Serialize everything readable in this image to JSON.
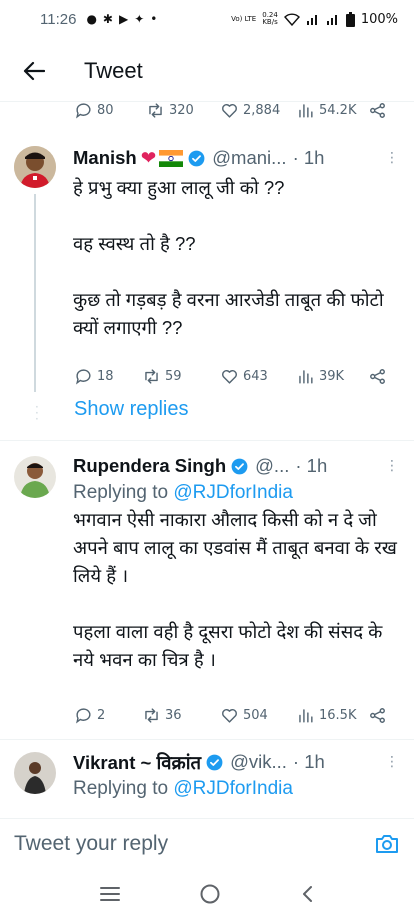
{
  "status_bar": {
    "time": "11:26",
    "network_top": "Vo) LTE",
    "speed_value": "0.24",
    "speed_unit": "KB/s",
    "battery": "100%"
  },
  "header": {
    "title": "Tweet"
  },
  "top_actions": {
    "replies": "80",
    "retweets": "320",
    "likes": "2,884",
    "views": "54.2K"
  },
  "tweets": [
    {
      "name": "Manish",
      "handle": "@mani...",
      "time": "· 1h",
      "text": "हे प्रभु क्या हुआ लालू जी को ??\n\nवह स्वस्थ तो है ??\n\nकुछ तो गड़बड़ है वरना आरजेडी ताबूत की फोटो क्यों लगाएगी  ??",
      "replies": "18",
      "retweets": "59",
      "likes": "643",
      "views": "39K"
    },
    {
      "name": "Rupendera Singh",
      "handle": "@...",
      "time": "· 1h",
      "replying_prefix": "Replying to",
      "replying_to": "@RJDforIndia",
      "text": "भगवान ऐसी नाकारा औलाद किसी को न दे जो अपने बाप लालू का एडवांस मैं ताबूत बनवा के रख लिये हैं ।\n\nपहला वाला वही है दूसरा फोटो देश की संसद के नये भवन का चित्र है ।",
      "replies": "2",
      "retweets": "36",
      "likes": "504",
      "views": "16.5K"
    },
    {
      "name": "Vikrant ~ विक्रांत",
      "handle": "@vik...",
      "time": "· 1h",
      "replying_prefix": "Replying to",
      "replying_to": "@RJDforIndia"
    }
  ],
  "show_replies": "Show replies",
  "reply_bar": {
    "placeholder": "Tweet your reply"
  },
  "colors": {
    "accent": "#1d9bf0",
    "secondary_text": "#536471",
    "heart": "#e0245e"
  }
}
